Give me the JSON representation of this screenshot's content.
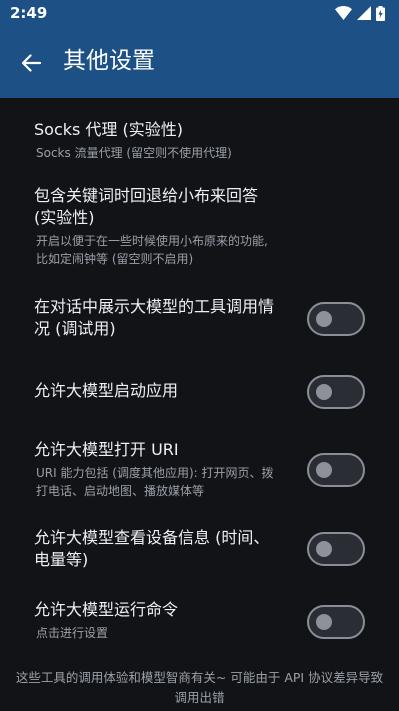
{
  "status_bar": {
    "time": "2:49"
  },
  "app_bar": {
    "title": "其他设置"
  },
  "settings": [
    {
      "title": "Socks 代理 (实验性)",
      "subtitle": "Socks 流量代理 (留空则不使用代理)"
    },
    {
      "title": "包含关键词时回退给小布来回答 (实验性)",
      "subtitle": "开启以便于在一些时候使用小布原来的功能, 比如定闹钟等 (留空则不启用)"
    },
    {
      "title": "在对话中展示大模型的工具调用情况 (调试用)",
      "enabled": false
    },
    {
      "title": "允许大模型启动应用",
      "enabled": false
    },
    {
      "title": "允许大模型打开 URI",
      "subtitle": "URI 能力包括 (调度其他应用): 打开网页、拨打电话、启动地图、播放媒体等",
      "enabled": false
    },
    {
      "title": "允许大模型查看设备信息 (时间、电量等)",
      "enabled": false
    },
    {
      "title": "允许大模型运行命令",
      "subtitle": "点击进行设置",
      "enabled": false
    }
  ],
  "footer": "这些工具的调用体验和模型智商有关~ 可能由于 API 协议差异导致调用出错"
}
